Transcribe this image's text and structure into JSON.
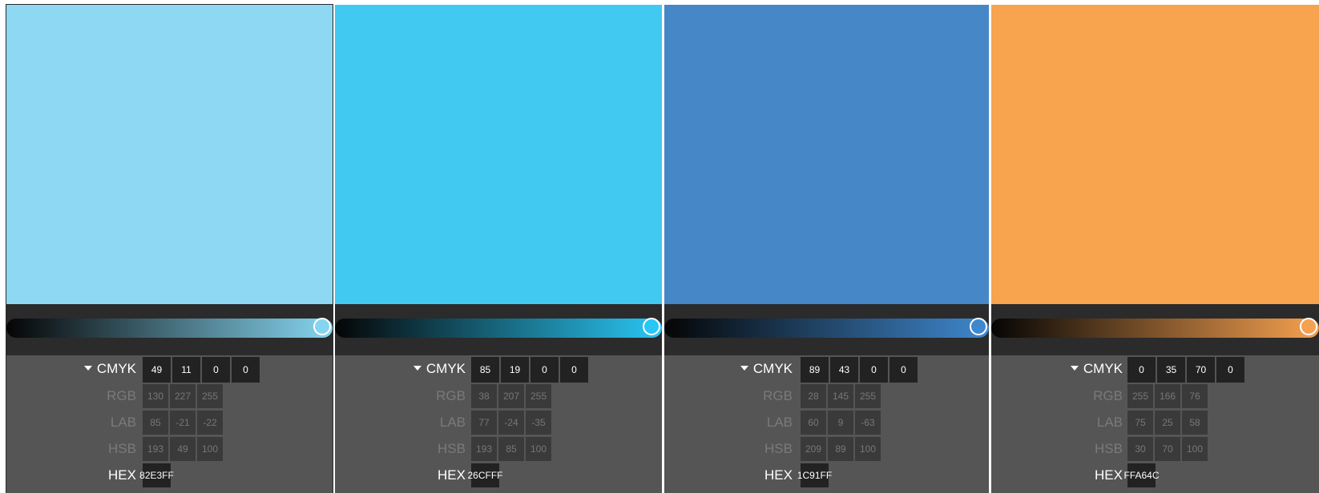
{
  "columns": [
    {
      "swatch_color": "#8ED8F3",
      "slider_gradient_end": "#86D5F0",
      "slider_position": 1.0,
      "cmyk": [
        "49",
        "11",
        "0",
        "0"
      ],
      "rgb": [
        "130",
        "227",
        "255"
      ],
      "lab": [
        "85",
        "-21",
        "-22"
      ],
      "hsb": [
        "193",
        "49",
        "100"
      ],
      "hex": "82E3FF",
      "selected": true
    },
    {
      "swatch_color": "#42C9F2",
      "slider_gradient_end": "#2AC6F4",
      "slider_position": 1.0,
      "cmyk": [
        "85",
        "19",
        "0",
        "0"
      ],
      "rgb": [
        "38",
        "207",
        "255"
      ],
      "lab": [
        "77",
        "-24",
        "-35"
      ],
      "hsb": [
        "193",
        "85",
        "100"
      ],
      "hex": "26CFFF",
      "selected": false
    },
    {
      "swatch_color": "#4587C7",
      "slider_gradient_end": "#3F88CF",
      "slider_position": 1.0,
      "cmyk": [
        "89",
        "43",
        "0",
        "0"
      ],
      "rgb": [
        "28",
        "145",
        "255"
      ],
      "lab": [
        "60",
        "9",
        "-63"
      ],
      "hsb": [
        "209",
        "89",
        "100"
      ],
      "hex": "1C91FF",
      "selected": false
    },
    {
      "swatch_color": "#F8A34E",
      "slider_gradient_end": "#F6A150",
      "slider_position": 1.0,
      "cmyk": [
        "0",
        "35",
        "70",
        "0"
      ],
      "rgb": [
        "255",
        "166",
        "76"
      ],
      "lab": [
        "75",
        "25",
        "58"
      ],
      "hsb": [
        "30",
        "70",
        "100"
      ],
      "hex": "FFA64C",
      "selected": false
    }
  ],
  "labels": {
    "cmyk": "CMYK",
    "rgb": "RGB",
    "lab": "LAB",
    "hsb": "HSB",
    "hex": "HEX"
  }
}
